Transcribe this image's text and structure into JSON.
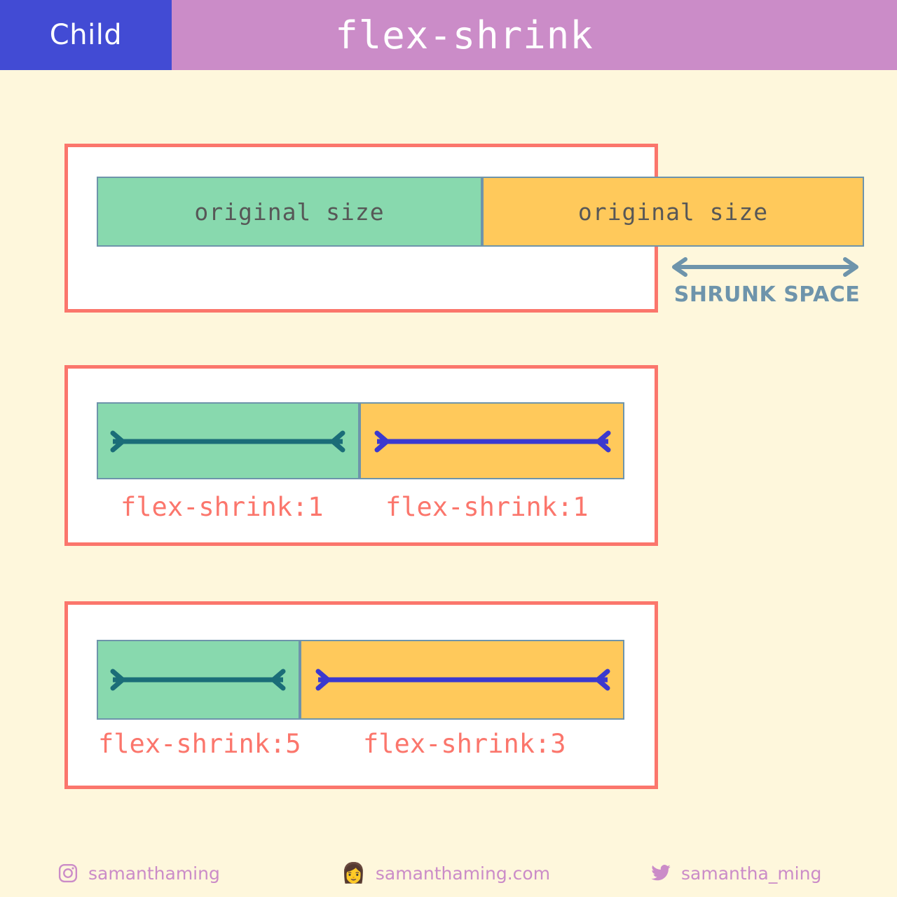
{
  "header": {
    "badge_label": "Child",
    "title": "flex-shrink",
    "badge_color": "#424BD4",
    "bar_color": "#CB8CC8"
  },
  "page": {
    "background_color": "#FEF7DC",
    "container_border_color": "#FB766C",
    "green_color": "#88D9AE",
    "yellow_color": "#FFC95B",
    "box_border_color": "#6E94AB",
    "accent_text_color": "#FB766C",
    "steel_color": "#6E94AB"
  },
  "diagrams": [
    {
      "name": "original-size-row",
      "boxes": [
        {
          "label": "original size",
          "color": "green"
        },
        {
          "label": "original size",
          "color": "yellow"
        }
      ],
      "annotation": {
        "label": "SHRUNK SPACE",
        "arrow": "double-headed-horizontal-arrow-icon"
      }
    },
    {
      "name": "equal-shrink-row",
      "boxes": [
        {
          "label": "",
          "color": "green",
          "arrow": "inward-arrow-icon",
          "arrow_color": "#1B6D78"
        },
        {
          "label": "",
          "color": "yellow",
          "arrow": "inward-arrow-icon",
          "arrow_color": "#3B39CF"
        }
      ],
      "captions": [
        "flex-shrink:1",
        "flex-shrink:1"
      ]
    },
    {
      "name": "unequal-shrink-row",
      "boxes": [
        {
          "label": "",
          "color": "green",
          "arrow": "inward-arrow-icon",
          "arrow_color": "#1B6D78"
        },
        {
          "label": "",
          "color": "yellow",
          "arrow": "inward-arrow-icon",
          "arrow_color": "#3B39CF"
        }
      ],
      "captions": [
        "flex-shrink:5",
        "flex-shrink:3"
      ]
    }
  ],
  "footer": {
    "items": [
      {
        "icon": "instagram-icon",
        "label": "samanthaming"
      },
      {
        "icon": "avatar-icon",
        "label": "samanthaming.com",
        "emoji": "👩"
      },
      {
        "icon": "twitter-icon",
        "label": "samantha_ming"
      }
    ]
  }
}
